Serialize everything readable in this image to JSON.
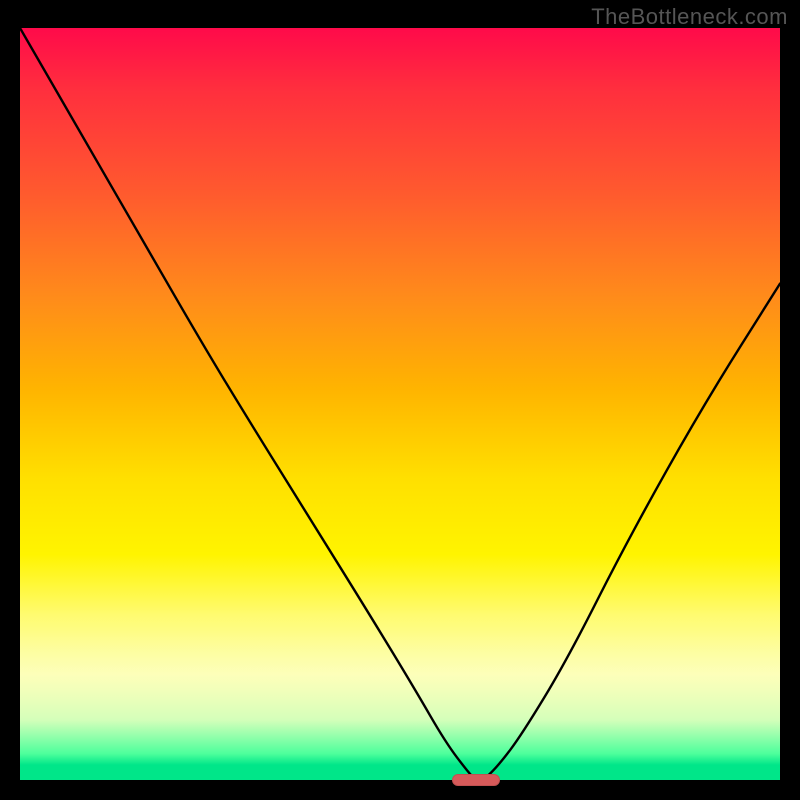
{
  "watermark": "TheBottleneck.com",
  "chart_data": {
    "type": "line",
    "title": "",
    "xlabel": "",
    "ylabel": "",
    "xlim": [
      0,
      100
    ],
    "ylim": [
      0,
      100
    ],
    "grid": false,
    "legend": false,
    "series": [
      {
        "name": "bottleneck-curve",
        "x": [
          0,
          8,
          16,
          24,
          30,
          38,
          46,
          52,
          56,
          59,
          60,
          61,
          63,
          66,
          72,
          80,
          90,
          100
        ],
        "values": [
          100,
          86,
          72,
          58,
          48,
          35,
          22,
          12,
          5,
          1,
          0,
          0,
          2,
          6,
          16,
          32,
          50,
          66
        ]
      }
    ],
    "marker": {
      "x": 60,
      "y": 0,
      "width_pct": 6.3,
      "color": "#d65a5a"
    },
    "background_gradient": {
      "top": "#ff0a4a",
      "mid": "#ffe000",
      "bottom": "#00e689"
    }
  }
}
